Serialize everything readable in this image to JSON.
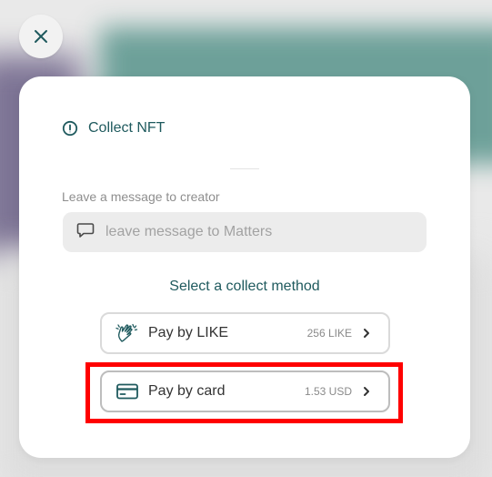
{
  "close_button": {
    "icon": "close-icon"
  },
  "dialog": {
    "title": "Collect NFT",
    "title_icon": "info-circle-icon",
    "message_label": "Leave a message to creator",
    "message_placeholder": "leave message to Matters",
    "message_icon": "speech-bubble-icon",
    "method_heading": "Select a collect method",
    "methods": [
      {
        "label": "Pay by LIKE",
        "price": "256 LIKE",
        "icon": "clap-hands-icon"
      },
      {
        "label": "Pay by card",
        "price": "1.53 USD",
        "icon": "credit-card-icon"
      }
    ]
  },
  "colors": {
    "accent": "#1f5a5e",
    "highlight": "#ff0000"
  }
}
